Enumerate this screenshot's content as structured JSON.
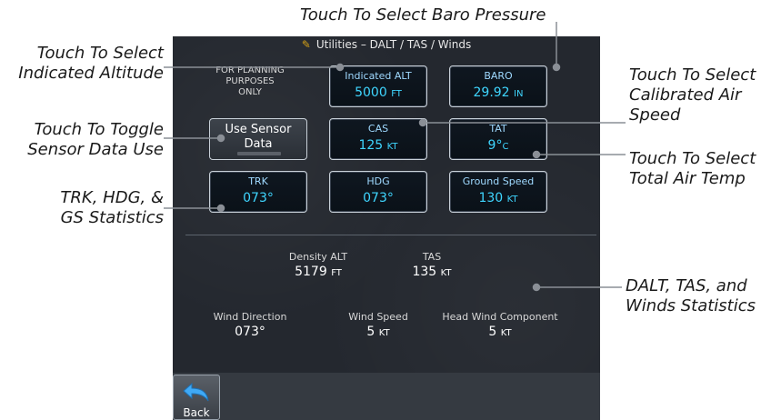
{
  "callouts": {
    "baro": "Touch To Select Baro Pressure",
    "altitude_line1": "Touch To Select",
    "altitude_line2": "Indicated Altitude",
    "sensor_line1": "Touch To Toggle",
    "sensor_line2": "Sensor Data Use",
    "trk_line1": "TRK, HDG, &",
    "trk_line2": "GS Statistics",
    "cas_line1": "Touch To Select",
    "cas_line2": "Calibrated Air",
    "cas_line3": "Speed",
    "tat_line1": "Touch To Select",
    "tat_line2": "Total Air Temp",
    "dalt_line1": "DALT, TAS, and",
    "dalt_line2": "Winds Statistics"
  },
  "screen": {
    "title": "Utilities – DALT / TAS / Winds",
    "planning_line1": "FOR PLANNING",
    "planning_line2": "PURPOSES",
    "planning_line3": "ONLY",
    "indicated_alt": {
      "label": "Indicated ALT",
      "value": "5000",
      "unit": "FT"
    },
    "baro": {
      "label": "BARO",
      "value": "29.92",
      "unit": "IN"
    },
    "use_sensor": {
      "line1": "Use Sensor",
      "line2": "Data"
    },
    "cas": {
      "label": "CAS",
      "value": "125",
      "unit": "KT"
    },
    "tat": {
      "label": "TAT",
      "value": "9°",
      "unit": "C"
    },
    "trk": {
      "label": "TRK",
      "value": "073°"
    },
    "hdg": {
      "label": "HDG",
      "value": "073°"
    },
    "ground_speed": {
      "label": "Ground Speed",
      "value": "130",
      "unit": "KT"
    },
    "density_alt": {
      "label": "Density ALT",
      "value": "5179",
      "unit": "FT"
    },
    "tas": {
      "label": "TAS",
      "value": "135",
      "unit": "KT"
    },
    "wind_direction": {
      "label": "Wind Direction",
      "value": "073°"
    },
    "wind_speed": {
      "label": "Wind Speed",
      "value": "5",
      "unit": "KT"
    },
    "head_wind": {
      "label": "Head Wind Component",
      "value": "5",
      "unit": "KT"
    },
    "back_label": "Back"
  }
}
